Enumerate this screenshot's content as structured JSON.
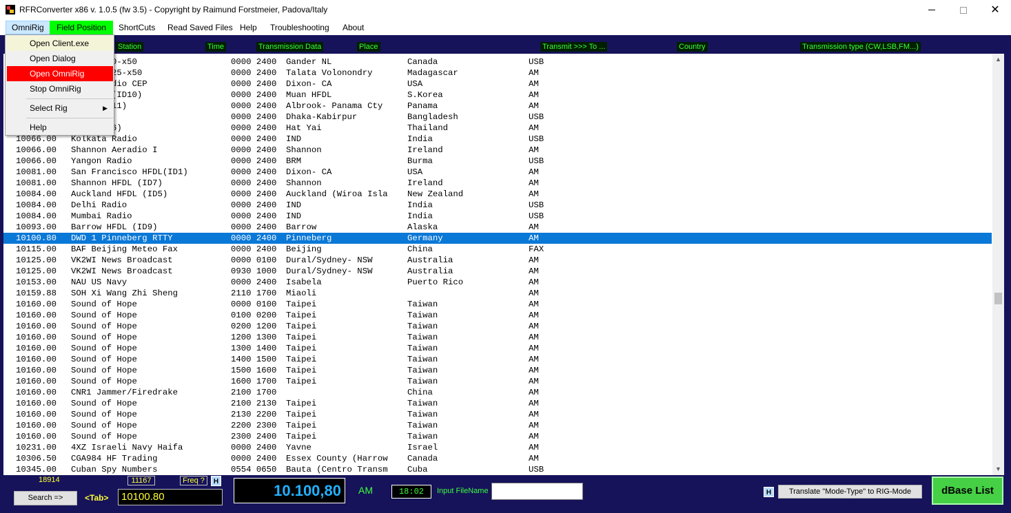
{
  "window": {
    "title": "RFRConverter x86 v. 1.0.5 (fw 3.5) - Copyright by Raimund Forstmeier, Padova/Italy"
  },
  "menubar": [
    "OmniRig",
    "Field Position",
    "ShortCuts",
    "Read Saved Files",
    "Help",
    "Troubleshooting",
    "About"
  ],
  "headers": {
    "station": "Station",
    "time": "Time",
    "transmission_data": "Transmission Data",
    "place": "Place",
    "transmit_to": "Transmit >>> To ...",
    "country": "Country",
    "transmission_type": "Transmission type (CW,LSB,FM...)"
  },
  "dropdown": {
    "open_client": "Open Client.exe",
    "open_dialog": "Open Dialog",
    "open_omnirig": "Open OmniRig",
    "stop_omnirig": "Stop OmniRig",
    "select_rig": "Select Rig",
    "help": "Help"
  },
  "rows": [
    {
      "freq": "",
      "station": "olmet x20-x50",
      "time": "0000 2400",
      "place": "Gander NL",
      "country": "Canada",
      "mode": "USB"
    },
    {
      "freq": "",
      "station": "Volmet x25-x50",
      "time": "0000 2400",
      "place": "Talata Volonondry",
      "country": "Madagascar",
      "mode": "AM"
    },
    {
      "freq": "",
      "station": "cisco Radio CEP",
      "time": "0000 2400",
      "place": "Dixon- CA",
      "country": "USA",
      "mode": "AM"
    },
    {
      "freq": "",
      "station": "an HFDL (ID10)",
      "time": "0000 2400",
      "place": "Muan HFDL",
      "country": "S.Korea",
      "mode": "AM"
    },
    {
      "freq": "",
      "station": "HFDL (ID11)",
      "time": "0000 2400",
      "place": "Albrook- Panama Cty",
      "country": "Panama",
      "mode": "AM"
    },
    {
      "freq": "",
      "station": "dio",
      "time": "0000 2400",
      "place": "Dhaka-Kabirpur",
      "country": "Bangladesh",
      "mode": "USB"
    },
    {
      "freq": "",
      "station": "HFDL (ID6)",
      "time": "0000 2400",
      "place": "Hat Yai",
      "country": "Thailand",
      "mode": "AM"
    },
    {
      "freq": "10066.00",
      "station": "Kolkata Radio",
      "time": "0000 2400",
      "place": "IND",
      "country": "India",
      "mode": "USB"
    },
    {
      "freq": "10066.00",
      "station": "Shannon Aeradio I",
      "time": "0000 2400",
      "place": "Shannon",
      "country": "Ireland",
      "mode": "AM"
    },
    {
      "freq": "10066.00",
      "station": "Yangon Radio",
      "time": "0000 2400",
      "place": "BRM",
      "country": "Burma",
      "mode": "USB"
    },
    {
      "freq": "10081.00",
      "station": "San Francisco HFDL(ID1)",
      "time": "0000 2400",
      "place": "Dixon- CA",
      "country": "USA",
      "mode": "AM"
    },
    {
      "freq": "10081.00",
      "station": "Shannon HFDL (ID7)",
      "time": "0000 2400",
      "place": "Shannon",
      "country": "Ireland",
      "mode": "AM"
    },
    {
      "freq": "10084.00",
      "station": "Auckland HFDL (ID5)",
      "time": "0000 2400",
      "place": "Auckland (Wiroa Isla",
      "country": "New Zealand",
      "mode": "AM"
    },
    {
      "freq": "10084.00",
      "station": "Delhi Radio",
      "time": "0000 2400",
      "place": "IND",
      "country": "India",
      "mode": "USB"
    },
    {
      "freq": "10084.00",
      "station": "Mumbai Radio",
      "time": "0000 2400",
      "place": "IND",
      "country": "India",
      "mode": "USB"
    },
    {
      "freq": "10093.00",
      "station": "Barrow HFDL (ID9)",
      "time": "0000 2400",
      "place": "Barrow",
      "country": "Alaska",
      "mode": "AM"
    },
    {
      "freq": "10100.80",
      "station": "DWD 1 Pinneberg RTTY",
      "time": "0000 2400",
      "place": "Pinneberg",
      "country": "Germany",
      "mode": "AM"
    },
    {
      "freq": "10115.00",
      "station": "BAF Beijing Meteo Fax",
      "time": "0000 2400",
      "place": "Beijing",
      "country": "China",
      "mode": "FAX"
    },
    {
      "freq": "10125.00",
      "station": "VK2WI News Broadcast",
      "time": "0000 0100",
      "place": "Dural/Sydney- NSW",
      "country": "Australia",
      "mode": "AM"
    },
    {
      "freq": "10125.00",
      "station": "VK2WI News Broadcast",
      "time": "0930 1000",
      "place": "Dural/Sydney- NSW",
      "country": "Australia",
      "mode": "AM"
    },
    {
      "freq": "10153.00",
      "station": "NAU US Navy",
      "time": "0000 2400",
      "place": "Isabela",
      "country": "Puerto Rico",
      "mode": "AM"
    },
    {
      "freq": "10159.88",
      "station": "SOH Xi Wang Zhi Sheng",
      "time": "2110 1700",
      "place": "Miaoli",
      "country": "",
      "mode": "AM"
    },
    {
      "freq": "10160.00",
      "station": "Sound of Hope",
      "time": "0000 0100",
      "place": "Taipei",
      "country": "Taiwan",
      "mode": "AM"
    },
    {
      "freq": "10160.00",
      "station": "Sound of Hope",
      "time": "0100 0200",
      "place": "Taipei",
      "country": "Taiwan",
      "mode": "AM"
    },
    {
      "freq": "10160.00",
      "station": "Sound of Hope",
      "time": "0200 1200",
      "place": "Taipei",
      "country": "Taiwan",
      "mode": "AM"
    },
    {
      "freq": "10160.00",
      "station": "Sound of Hope",
      "time": "1200 1300",
      "place": "Taipei",
      "country": "Taiwan",
      "mode": "AM"
    },
    {
      "freq": "10160.00",
      "station": "Sound of Hope",
      "time": "1300 1400",
      "place": "Taipei",
      "country": "Taiwan",
      "mode": "AM"
    },
    {
      "freq": "10160.00",
      "station": "Sound of Hope",
      "time": "1400 1500",
      "place": "Taipei",
      "country": "Taiwan",
      "mode": "AM"
    },
    {
      "freq": "10160.00",
      "station": "Sound of Hope",
      "time": "1500 1600",
      "place": "Taipei",
      "country": "Taiwan",
      "mode": "AM"
    },
    {
      "freq": "10160.00",
      "station": "Sound of Hope",
      "time": "1600 1700",
      "place": "Taipei",
      "country": "Taiwan",
      "mode": "AM"
    },
    {
      "freq": "10160.00",
      "station": "CNR1 Jammer/Firedrake",
      "time": "2100 1700",
      "place": "",
      "country": "China",
      "mode": "AM"
    },
    {
      "freq": "10160.00",
      "station": "Sound of Hope",
      "time": "2100 2130",
      "place": "Taipei",
      "country": "Taiwan",
      "mode": "AM"
    },
    {
      "freq": "10160.00",
      "station": "Sound of Hope",
      "time": "2130 2200",
      "place": "Taipei",
      "country": "Taiwan",
      "mode": "AM"
    },
    {
      "freq": "10160.00",
      "station": "Sound of Hope",
      "time": "2200 2300",
      "place": "Taipei",
      "country": "Taiwan",
      "mode": "AM"
    },
    {
      "freq": "10160.00",
      "station": "Sound of Hope",
      "time": "2300 2400",
      "place": "Taipei",
      "country": "Taiwan",
      "mode": "AM"
    },
    {
      "freq": "10231.00",
      "station": "4XZ Israeli Navy Haifa",
      "time": "0000 2400",
      "place": "Yavne",
      "country": "Israel",
      "mode": "AM"
    },
    {
      "freq": "10306.50",
      "station": "CGA984 HF Trading",
      "time": "0000 2400",
      "place": "Essex County (Harrow",
      "country": "Canada",
      "mode": "AM"
    },
    {
      "freq": "10345.00",
      "station": "Cuban Spy Numbers",
      "time": "0554 0650",
      "place": "Bauta (Centro Transm",
      "country": "Cuba",
      "mode": "USB"
    }
  ],
  "selected_row": 16,
  "bottom": {
    "count": "18914",
    "index": "11167",
    "freq_q": "Freq ?",
    "h_badge": "H",
    "search_button": "Search =>",
    "tab_label": "<Tab>",
    "freq_input": "10100.80",
    "freq_display": "10.100,80",
    "mode": "AM",
    "time": "18:02",
    "input_filename_label": "Input FileName",
    "input_filename_value": "",
    "translate_button": "Translate \"Mode-Type\" to RIG-Mode",
    "dbase_button": "dBase List"
  },
  "colors": {
    "panel_bg": "#16135a",
    "header_text": "#3cff3c",
    "selected_row": "#0a78d7",
    "field_position": "#00ff00",
    "open_omnirig": "#ff0000",
    "dbase_button": "#45d045"
  }
}
